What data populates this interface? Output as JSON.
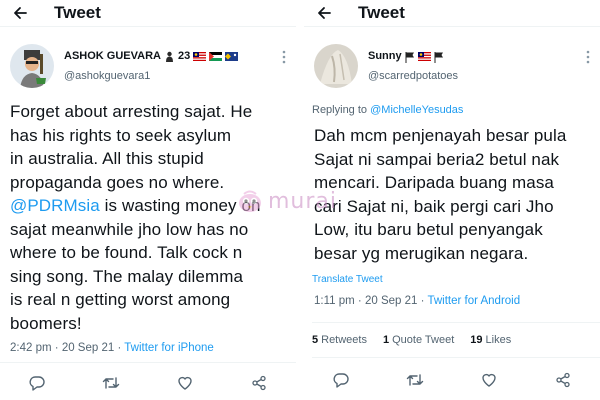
{
  "left": {
    "topbar": {
      "title": "Tweet"
    },
    "user": {
      "name": "ASHOK GUEVARA",
      "badge_number": "23",
      "handle": "@ashokguevara1"
    },
    "tweet": {
      "text_before_mention": "Forget about arresting sajat. He\nhas his rights to seek asylum\nin australia. All this stupid\npropaganda goes no where.\n",
      "mention": "@PDRMsia",
      "text_after_mention": " is wasting money on\nsajat meanwhile jho low has no\nwhere to be found. Talk cock n\nsing song. The malay dilemma\nis real n getting worst among\nboomers!"
    },
    "meta": {
      "time": "2:42 pm",
      "date": "20 Sep 21",
      "source": "Twitter for iPhone"
    },
    "icons": [
      "arrow-left-icon",
      "more-icon",
      "reply-icon",
      "retweet-icon",
      "like-icon",
      "share-icon"
    ]
  },
  "right": {
    "topbar": {
      "title": "Tweet"
    },
    "user": {
      "name": "Sunny",
      "handle": "@scarredpotatoes"
    },
    "replying": {
      "label": "Replying to",
      "mention": "@MichelleYesudas"
    },
    "tweet": {
      "text": "Dah mcm penjenayah besar pula\nSajat ni sampai beria2 betul nak\nmencari. Daripada buang masa\ncari Sajat ni, baik pergi cari Jho\nLow, itu baru betul penyangak\nbesar yg merugikan negara."
    },
    "translate": "Translate Tweet",
    "meta": {
      "time": "1:11 pm",
      "date": "20 Sep 21",
      "source": "Twitter for Android"
    },
    "stats": {
      "retweets_count": "5",
      "retweets_label": "Retweets",
      "quotes_count": "1",
      "quotes_label": "Quote Tweet",
      "likes_count": "19",
      "likes_label": "Likes"
    },
    "icons": [
      "arrow-left-icon",
      "more-icon",
      "reply-icon",
      "retweet-icon",
      "like-icon",
      "share-icon"
    ]
  },
  "watermark": {
    "text": "murai"
  },
  "colors": {
    "link": "#1d9bf0",
    "text": "#0f1419",
    "muted": "#536471",
    "border": "#eff3f4",
    "watermark": "#c98ac2"
  },
  "separator": "·"
}
